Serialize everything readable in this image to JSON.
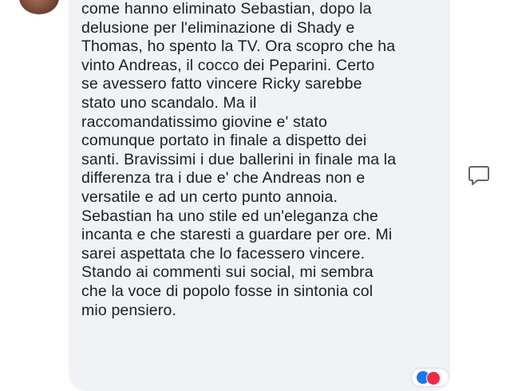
{
  "comment": {
    "lines": [
      "come hanno eliminato Sebastian, dopo la",
      "delusione per l'eliminazione di Shady e",
      "Thomas, ho spento la TV. Ora scopro che ha",
      "vinto Andreas, il cocco dei Peparini. Certo",
      "se avessero fatto vincere Ricky sarebbe",
      "stato uno scandalo. Ma il",
      "raccomandatissimo giovine e' stato",
      "comunque portato in finale a dispetto dei",
      "santi. Bravissimi i due ballerini in finale ma la",
      "differenza tra i due e' che Andreas non e",
      "versatile e ad un certo punto annoia.",
      "Sebastian ha uno stile ed un'eleganza che",
      "incanta e che staresti a guardare per ore. Mi",
      "sarei aspettata che lo facessero vincere.",
      "Stando ai commenti sui social, mi sembra",
      "che la voce di popolo fosse in sintonia col",
      "mio pensiero."
    ]
  },
  "icons": {
    "reply": "speech-bubble-icon",
    "avatar": "user-avatar"
  },
  "colors": {
    "bubble_bg": "#f1f2f6",
    "text": "#1c1e21",
    "icon_stroke": "#606770"
  }
}
